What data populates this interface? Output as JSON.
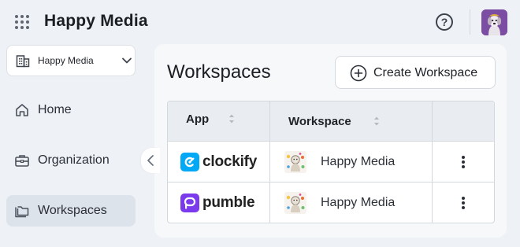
{
  "header": {
    "app_title": "Happy Media",
    "help_label": "?",
    "grid_icon": "apps-grid-icon",
    "avatar_icon": "dog-avatar"
  },
  "sidebar": {
    "workspace_selector": {
      "label": "Happy Media",
      "icon": "building-icon"
    },
    "items": [
      {
        "label": "Home",
        "icon": "home-icon",
        "active": false
      },
      {
        "label": "Organization",
        "icon": "briefcase-icon",
        "active": false
      },
      {
        "label": "Workspaces",
        "icon": "folder-icon",
        "active": true
      }
    ]
  },
  "main": {
    "title": "Workspaces",
    "create_button": "Create Workspace",
    "table": {
      "columns": [
        "App",
        "Workspace",
        ""
      ],
      "rows": [
        {
          "app": "clockify",
          "app_color": "#03a9f4",
          "workspace": "Happy Media"
        },
        {
          "app": "pumble",
          "app_color": "#7c3aed",
          "workspace": "Happy Media"
        }
      ]
    }
  },
  "colors": {
    "background": "#eef1f5",
    "panel": "#f7f8fa",
    "active_nav": "#dde3ea",
    "clockify_brand": "#03a9f4",
    "pumble_brand": "#7c3aed"
  }
}
